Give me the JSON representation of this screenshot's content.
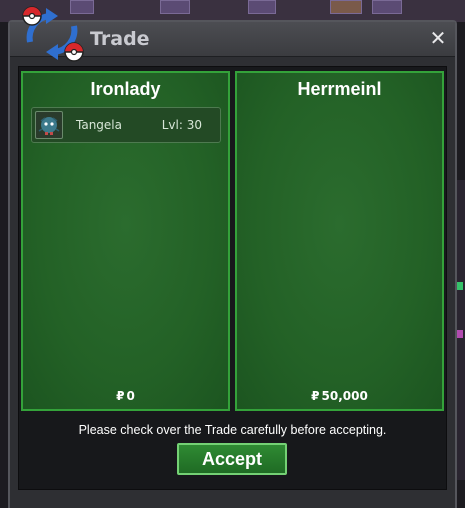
{
  "window": {
    "title": "Trade",
    "close_label": "✕"
  },
  "left_panel": {
    "player_name": "Ironlady",
    "items": [
      {
        "name": "Tangela",
        "level": "Lvl: 30",
        "icon": "tangela-icon"
      }
    ],
    "money_symbol": "₽",
    "money": "0"
  },
  "right_panel": {
    "player_name": "Herrmeinl",
    "items": [],
    "money_symbol": "₽",
    "money": "50,000"
  },
  "notice": "Please check over the Trade carefully before accepting.",
  "accept_label": "Accept",
  "colors": {
    "panel_green": "#236126",
    "panel_border": "#34a23a",
    "button_green": "#2f8a33",
    "title_gray": "#c9cad0"
  }
}
